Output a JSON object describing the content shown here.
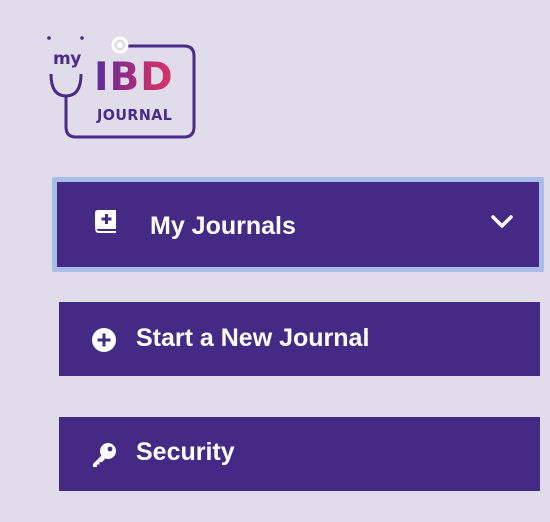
{
  "logo": {
    "my": "my",
    "ibd": "IBD",
    "journal": "JOURNAL",
    "icon": "stethoscope-icon"
  },
  "menu": {
    "items": [
      {
        "label": "My Journals",
        "icon": "journal-add-icon",
        "expandable": true,
        "focused": true
      },
      {
        "label": "Start a New Journal",
        "icon": "plus-circle-icon"
      },
      {
        "label": "Security",
        "icon": "key-icon"
      }
    ]
  },
  "colors": {
    "background": "#e0dcea",
    "menu_bg": "#452a85",
    "focus_ring": "#a8bde8",
    "logo_purple": "#4b2a8a",
    "logo_pink": "#c0306c"
  }
}
